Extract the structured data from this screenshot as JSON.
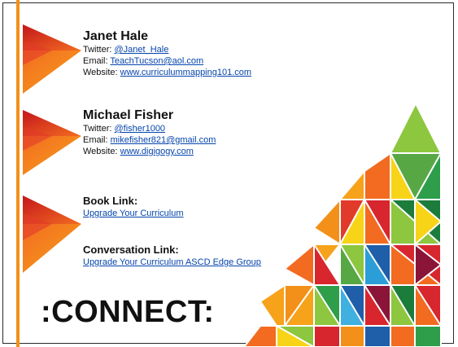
{
  "slide": {
    "people": [
      {
        "name": "Janet Hale",
        "twitter_label": "Twitter:",
        "twitter_value": "@Janet_Hale",
        "email_label": "Email:",
        "email_value": "TeachTucson@aol.com",
        "website_label": "Website:",
        "website_value": "www.curriculummapping101.com"
      },
      {
        "name": "Michael Fisher",
        "twitter_label": "Twitter:",
        "twitter_value": "@fisher1000",
        "email_label": "Email:",
        "email_value": "mikefisher821@gmail.com",
        "website_label": "Website:",
        "website_value": "www.digigogy.com"
      }
    ],
    "book_link": {
      "heading": "Book Link:",
      "link_text": "Upgrade Your Curriculum"
    },
    "conversation_link": {
      "heading": "Conversation Link:",
      "link_text": "Upgrade Your Curriculum ASCD Edge Group"
    },
    "title": ":CONNECT:"
  },
  "colors": {
    "accent_orange": "#f39019",
    "link_blue": "#0645ad",
    "triangle_red": "#d8262f",
    "triangle_orange": "#f26b21"
  }
}
